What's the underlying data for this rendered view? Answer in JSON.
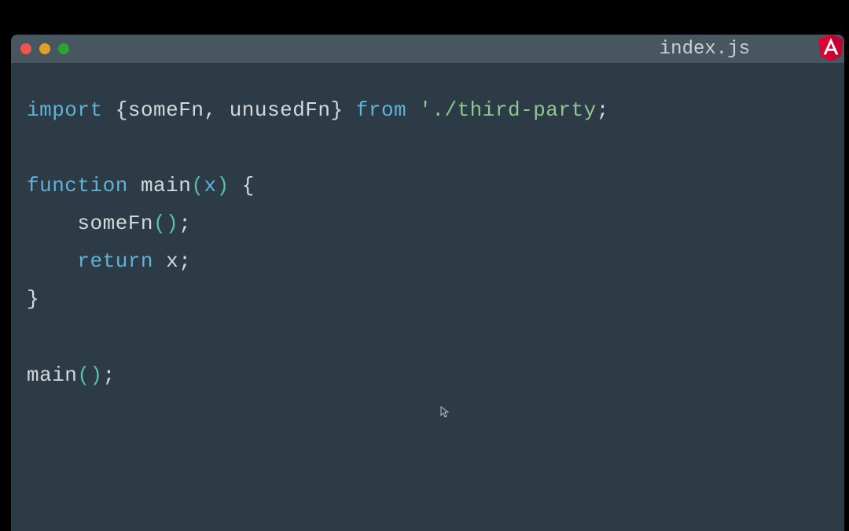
{
  "titleBar": {
    "fileName": "index.js"
  },
  "code": {
    "line1": {
      "import": "import",
      "brace1": " {",
      "someFn": "someFn",
      "comma": ", ",
      "unusedFn": "unusedFn",
      "brace2": "} ",
      "from": "from",
      "space": " ",
      "quote1": "'",
      "path": "./third-party",
      "semi": ";"
    },
    "line3": {
      "function": "function",
      "space1": " ",
      "name": "main",
      "paren1": "(",
      "param": "x",
      "paren2": ")",
      "space2": " ",
      "brace": "{"
    },
    "line4": {
      "indent": "    ",
      "call": "someFn",
      "parens": "()",
      "semi": ";"
    },
    "line5": {
      "indent": "    ",
      "return": "return",
      "space": " ",
      "var": "x",
      "semi": ";"
    },
    "line6": {
      "brace": "}"
    },
    "line8": {
      "call": "main",
      "parens": "()",
      "semi": ";"
    }
  }
}
